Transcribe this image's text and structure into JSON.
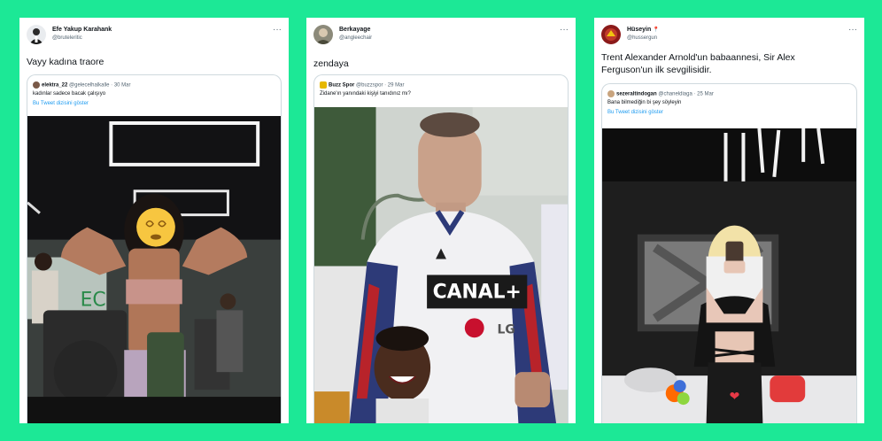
{
  "colors": {
    "background": "#1ce896",
    "link": "#1d9bf0",
    "muted": "#536471"
  },
  "cards": [
    {
      "user_name": "Efe Yakup Karahank",
      "handle": "@bruteleritic",
      "more": "···",
      "tweet": "Vayy kadına traore",
      "quote": {
        "name": "elektra_22",
        "handle": "@gelecelhalkalle",
        "date": "· 30 Mar",
        "text": "kadınlar sadece bacak çalışıyo",
        "link": "Bu Tweet dizisini göster"
      },
      "media_icon": "gym-photo"
    },
    {
      "user_name": "Berkayage",
      "handle": "@angleechair",
      "more": "···",
      "tweet": "zendaya",
      "quote": {
        "name": "Buzz Spor",
        "handle": "@buzzspor",
        "date": "· 29 Mar",
        "text": "Zidane'ın yanındaki kişiyi tanıdınız mı?",
        "link": "",
        "jersey_sponsor": "CANAL+",
        "jersey_brand": "LG"
      },
      "media_icon": "football-photo"
    },
    {
      "user_name": "Hüseyin",
      "name_emoji": "📍",
      "handle": "@hussergun",
      "more": "···",
      "tweet_line1": "Trent Alexander Arnold'un babaannesi, Sir Alex",
      "tweet_line2": "Ferguson'un ilk sevgilisidir.",
      "quote": {
        "name": "sezeraltindogan",
        "handle": "@chaneldiaga",
        "date": "· 25 Mar",
        "text": "Bana bilmediğin bi şey söyleyin",
        "link": "Bu Tweet dizisini göster"
      },
      "media_icon": "mirror-selfie-photo"
    }
  ]
}
